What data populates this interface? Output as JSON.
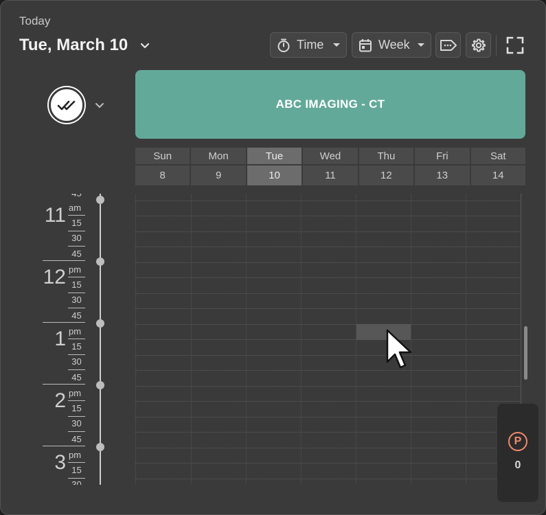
{
  "header": {
    "today_label": "Today",
    "date_title": "Tue, March 10"
  },
  "toolbar": {
    "time_label": "Time",
    "week_label": "Week",
    "icons": [
      "timer-icon",
      "calendar-icon",
      "tag-icon",
      "gear-icon",
      "fullscreen-icon"
    ]
  },
  "resource": {
    "name": "ABC IMAGING - CT",
    "color": "#63a99a"
  },
  "week": {
    "days": [
      {
        "name": "Sun",
        "num": "8"
      },
      {
        "name": "Mon",
        "num": "9"
      },
      {
        "name": "Tue",
        "num": "10",
        "selected": true
      },
      {
        "name": "Wed",
        "num": "11"
      },
      {
        "name": "Thu",
        "num": "12"
      },
      {
        "name": "Fri",
        "num": "13"
      },
      {
        "name": "Sat",
        "num": "14"
      }
    ]
  },
  "timeline": {
    "hours": [
      {
        "hour": "11",
        "ampm": "am"
      },
      {
        "hour": "12",
        "ampm": "pm"
      },
      {
        "hour": "1",
        "ampm": "pm"
      },
      {
        "hour": "2",
        "ampm": "pm"
      },
      {
        "hour": "3",
        "ampm": "pm"
      }
    ],
    "minute_marks": [
      "15",
      "30",
      "45"
    ],
    "partial_top": "45",
    "partial_bottom": "30"
  },
  "pending": {
    "icon_letter": "P",
    "count": "0",
    "accent": "#f08a6c"
  }
}
